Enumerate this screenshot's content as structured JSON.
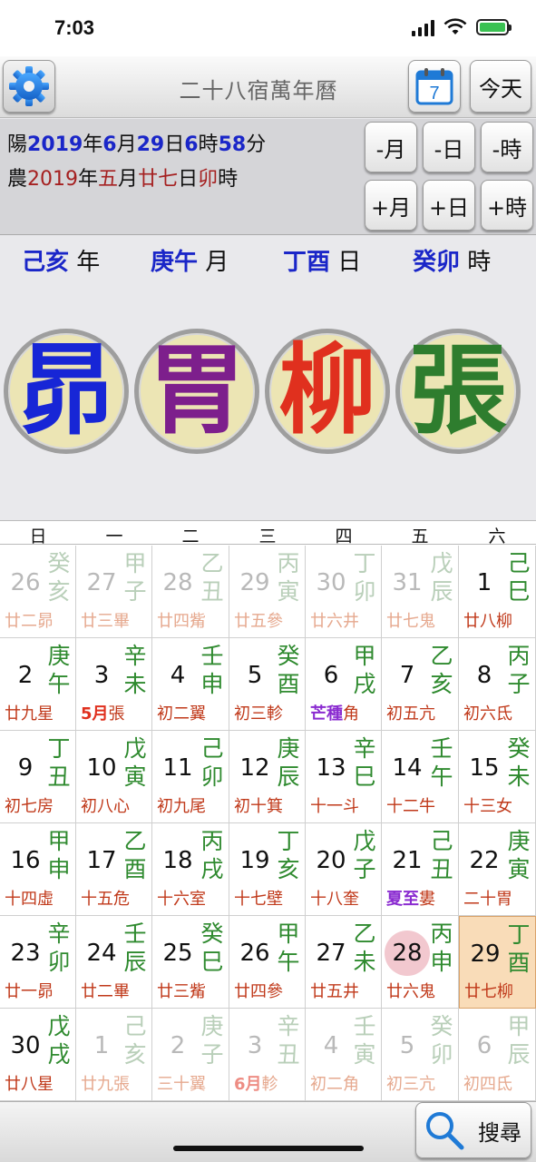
{
  "status": {
    "time": "7:03"
  },
  "toolbar": {
    "title": "二十八宿萬年曆",
    "calendar_icon_number": "7",
    "today_label": "今天"
  },
  "info": {
    "solar": [
      "陽",
      "2019",
      "年",
      "6",
      "月",
      "29",
      "日",
      "6",
      "時",
      "58",
      "分"
    ],
    "lunar": [
      "農",
      "2019",
      "年",
      "五",
      "月",
      "廿七",
      "日",
      "卯",
      "時"
    ]
  },
  "nav": {
    "minus_month": "-月",
    "minus_day": "-日",
    "minus_hour": "-時",
    "plus_month": "+月",
    "plus_day": "+日",
    "plus_hour": "+時"
  },
  "pillars": [
    {
      "gz": "己亥",
      "unit": "年"
    },
    {
      "gz": "庚午",
      "unit": "月"
    },
    {
      "gz": "丁酉",
      "unit": "日"
    },
    {
      "gz": "癸卯",
      "unit": "時"
    }
  ],
  "mansions": [
    {
      "char": "昴",
      "color": "#1726d6"
    },
    {
      "char": "胃",
      "color": "#7d1f8c"
    },
    {
      "char": "柳",
      "color": "#e0301e"
    },
    {
      "char": "張",
      "color": "#2e7d2e"
    }
  ],
  "weekdays": [
    "日",
    "一",
    "二",
    "三",
    "四",
    "五",
    "六"
  ],
  "weeks": [
    [
      {
        "day": "26",
        "gz": "癸亥",
        "lunar": "廿二",
        "star": "昴",
        "other": true
      },
      {
        "day": "27",
        "gz": "甲子",
        "lunar": "廿三",
        "star": "畢",
        "other": true
      },
      {
        "day": "28",
        "gz": "乙丑",
        "lunar": "廿四",
        "star": "觜",
        "other": true
      },
      {
        "day": "29",
        "gz": "丙寅",
        "lunar": "廿五",
        "star": "參",
        "other": true
      },
      {
        "day": "30",
        "gz": "丁卯",
        "lunar": "廿六",
        "star": "井",
        "other": true
      },
      {
        "day": "31",
        "gz": "戊辰",
        "lunar": "廿七",
        "star": "鬼",
        "other": true
      },
      {
        "day": "1",
        "gz": "己巳",
        "lunar": "廿八",
        "star": "柳"
      }
    ],
    [
      {
        "day": "2",
        "gz": "庚午",
        "lunar": "廿九",
        "star": "星"
      },
      {
        "day": "3",
        "gz": "辛未",
        "lunar": "5月",
        "star": "張",
        "lunar_color": "#e0301e",
        "lunar_bold": true
      },
      {
        "day": "4",
        "gz": "壬申",
        "lunar": "初二",
        "star": "翼"
      },
      {
        "day": "5",
        "gz": "癸酉",
        "lunar": "初三",
        "star": "軫"
      },
      {
        "day": "6",
        "gz": "甲戌",
        "lunar": "芒種",
        "star": "角",
        "lunar_color": "#8a2bd0",
        "lunar_bold": true
      },
      {
        "day": "7",
        "gz": "乙亥",
        "lunar": "初五",
        "star": "亢"
      },
      {
        "day": "8",
        "gz": "丙子",
        "lunar": "初六",
        "star": "氐"
      }
    ],
    [
      {
        "day": "9",
        "gz": "丁丑",
        "lunar": "初七",
        "star": "房"
      },
      {
        "day": "10",
        "gz": "戊寅",
        "lunar": "初八",
        "star": "心"
      },
      {
        "day": "11",
        "gz": "己卯",
        "lunar": "初九",
        "star": "尾"
      },
      {
        "day": "12",
        "gz": "庚辰",
        "lunar": "初十",
        "star": "箕"
      },
      {
        "day": "13",
        "gz": "辛巳",
        "lunar": "十一",
        "star": "斗"
      },
      {
        "day": "14",
        "gz": "壬午",
        "lunar": "十二",
        "star": "牛"
      },
      {
        "day": "15",
        "gz": "癸未",
        "lunar": "十三",
        "star": "女"
      }
    ],
    [
      {
        "day": "16",
        "gz": "甲申",
        "lunar": "十四",
        "star": "虛"
      },
      {
        "day": "17",
        "gz": "乙酉",
        "lunar": "十五",
        "star": "危"
      },
      {
        "day": "18",
        "gz": "丙戌",
        "lunar": "十六",
        "star": "室"
      },
      {
        "day": "19",
        "gz": "丁亥",
        "lunar": "十七",
        "star": "壁"
      },
      {
        "day": "20",
        "gz": "戊子",
        "lunar": "十八",
        "star": "奎"
      },
      {
        "day": "21",
        "gz": "己丑",
        "lunar": "夏至",
        "star": "婁",
        "lunar_color": "#8a2bd0",
        "lunar_bold": true
      },
      {
        "day": "22",
        "gz": "庚寅",
        "lunar": "二十",
        "star": "胃"
      }
    ],
    [
      {
        "day": "23",
        "gz": "辛卯",
        "lunar": "廿一",
        "star": "昴"
      },
      {
        "day": "24",
        "gz": "壬辰",
        "lunar": "廿二",
        "star": "畢"
      },
      {
        "day": "25",
        "gz": "癸巳",
        "lunar": "廿三",
        "star": "觜"
      },
      {
        "day": "26",
        "gz": "甲午",
        "lunar": "廿四",
        "star": "參"
      },
      {
        "day": "27",
        "gz": "乙未",
        "lunar": "廿五",
        "star": "井"
      },
      {
        "day": "28",
        "gz": "丙申",
        "lunar": "廿六",
        "star": "鬼",
        "today": true
      },
      {
        "day": "29",
        "gz": "丁酉",
        "lunar": "廿七",
        "star": "柳",
        "selected": true
      }
    ],
    [
      {
        "day": "30",
        "gz": "戊戌",
        "lunar": "廿八",
        "star": "星"
      },
      {
        "day": "1",
        "gz": "己亥",
        "lunar": "廿九",
        "star": "張",
        "other": true
      },
      {
        "day": "2",
        "gz": "庚子",
        "lunar": "三十",
        "star": "翼",
        "other": true
      },
      {
        "day": "3",
        "gz": "辛丑",
        "lunar": "6月",
        "star": "軫",
        "other": true,
        "lunar_color": "#e0301e",
        "lunar_bold": true
      },
      {
        "day": "4",
        "gz": "壬寅",
        "lunar": "初二",
        "star": "角",
        "other": true
      },
      {
        "day": "5",
        "gz": "癸卯",
        "lunar": "初三",
        "star": "亢",
        "other": true
      },
      {
        "day": "6",
        "gz": "甲辰",
        "lunar": "初四",
        "star": "氐",
        "other": true
      }
    ]
  ],
  "bottom": {
    "search_label": "搜尋"
  }
}
